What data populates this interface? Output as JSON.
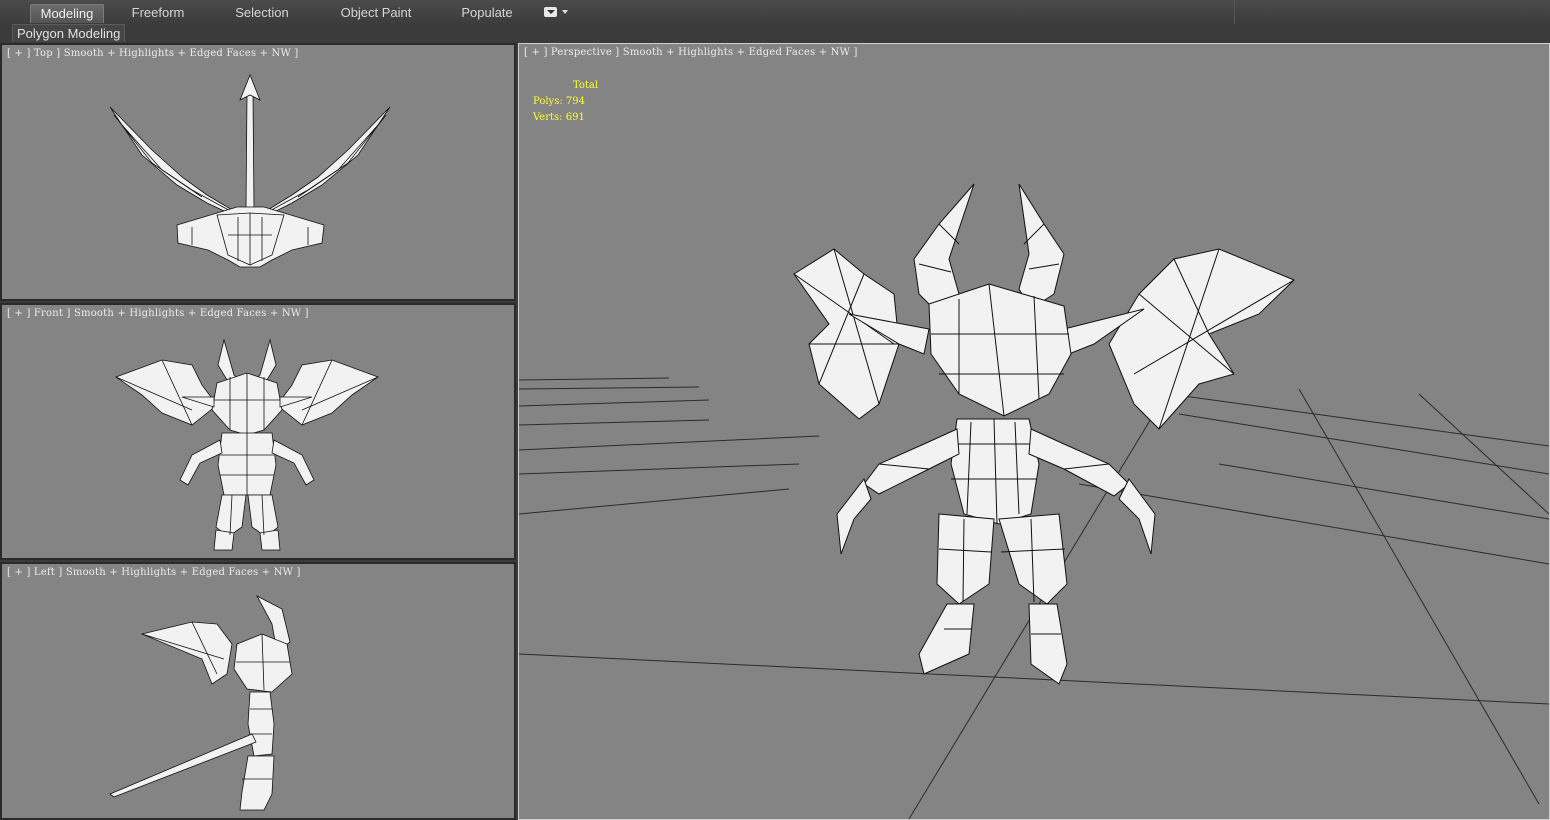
{
  "ribbon": {
    "tabs": [
      {
        "label": "Modeling",
        "active": true
      },
      {
        "label": "Freeform",
        "active": false
      },
      {
        "label": "Selection",
        "active": false
      },
      {
        "label": "Object Paint",
        "active": false
      },
      {
        "label": "Populate",
        "active": false
      }
    ],
    "options_icon": "dropdown-options-icon"
  },
  "subbar": {
    "label": "Polygon Modeling"
  },
  "viewports": {
    "top": {
      "label": "[ + ] Top ] Smooth + Highlights + Edged Faces + NW ]"
    },
    "front": {
      "label": "[ + ] Front ] Smooth + Highlights + Edged Faces + NW ]"
    },
    "left": {
      "label": "[ + ] Left ] Smooth + Highlights + Edged Faces + NW ]"
    },
    "perspective": {
      "label": "[ + ] Perspective ] Smooth + Highlights + Edged Faces + NW ]"
    }
  },
  "stats": {
    "header": "Total",
    "polys_label": "Polys:",
    "polys_value": "794",
    "verts_label": "Verts:",
    "verts_value": "691"
  },
  "colors": {
    "viewport_bg": "#848484",
    "ui_bg": "#3a3a3a",
    "stats_text": "#ffff33",
    "model_fill": "#f2f2f2",
    "wire": "#111111"
  }
}
